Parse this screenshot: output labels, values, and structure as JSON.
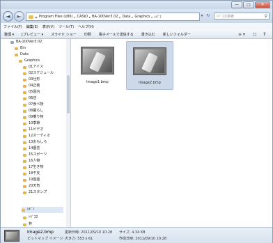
{
  "window": {
    "minimize_glyph": "—",
    "maximize_glyph": "□",
    "close_glyph": "✕"
  },
  "nav_buttons": {
    "back_glyph": "◄",
    "forward_glyph": "►"
  },
  "address": {
    "crumbs": [
      "Program Files (x86)",
      "CASIO",
      "BA-100Ver3.02",
      "Data",
      "Graphics",
      "ﾄｷﾞﾌ"
    ],
    "separator": "▸",
    "leading_separator": "▸▸"
  },
  "search": {
    "placeholder": "ﾄｷﾞﾌの検索",
    "icon": "search-icon"
  },
  "menu": [
    "ファイル(F)",
    "編集(E)",
    "表示(V)",
    "ツール(T)",
    "ヘルプ(H)"
  ],
  "toolbar": {
    "items": [
      "整理 ▾",
      "[プレビュー ▾",
      "スライド ショー",
      "印刷",
      "電子メールで送信する",
      "書き込む",
      "新しいフォルダー"
    ],
    "view_glyph": "≡ ▾",
    "pane_glyph": "□",
    "help_glyph": "?"
  },
  "nav_tree": [
    "BA-100Ver3.02",
    "Bin",
    "Data",
    "Graphics",
    "01アイス",
    "02スケジュール",
    "03仕形",
    "04正装",
    "05屋内",
    "06店",
    "07食べ物",
    "08暮らし",
    "09乗り物",
    "10季節",
    "11ビデオ",
    "12オーディオ",
    "13おもしろ",
    "14園芸",
    "15スポーツ",
    "16人物",
    "17生き物",
    "18干支",
    "19屋座",
    "20天気",
    "21スタンプ",
    "ﾄｷﾞﾌ",
    "ﾄｷﾞﾌ2",
    "枠"
  ],
  "files": [
    {
      "name": "Image1.bmp"
    },
    {
      "name": "Image2.bmp"
    }
  ],
  "details": {
    "filename": "Image2.bmp",
    "type": "ビットマップ イメージ",
    "modified": "更新日時: 2011/09/10 10:28",
    "dimensions": "大きさ: 553 x 61",
    "size": "サイズ: 4.34 KB",
    "created": "作成日時: 2011/09/10 10:28"
  }
}
